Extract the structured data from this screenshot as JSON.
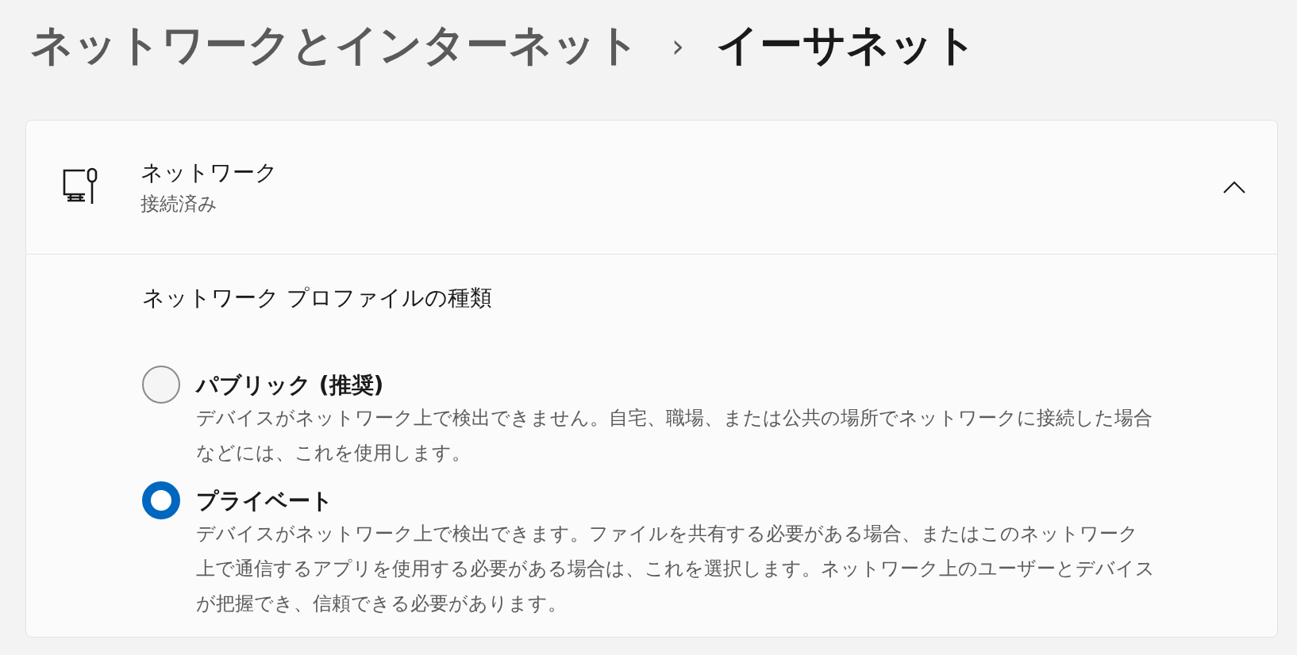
{
  "breadcrumb": {
    "parent": "ネットワークとインターネット",
    "separator": "›",
    "current": "イーサネット"
  },
  "network": {
    "name": "ネットワーク",
    "status": "接続済み",
    "expanded": true
  },
  "profile": {
    "title": "ネットワーク プロファイルの種類",
    "options": [
      {
        "label": "パブリック (推奨)",
        "description": "デバイスがネットワーク上で検出できません。自宅、職場、または公共の場所でネットワークに接続した場合などには、これを使用します。",
        "selected": false
      },
      {
        "label": "プライベート",
        "description": "デバイスがネットワーク上で検出できます。ファイルを共有する必要がある場合、またはこのネットワーク上で通信するアプリを使用する必要がある場合は、これを選択します。ネットワーク上のユーザーとデバイスが把握でき、信頼できる必要があります。",
        "selected": true
      }
    ]
  }
}
